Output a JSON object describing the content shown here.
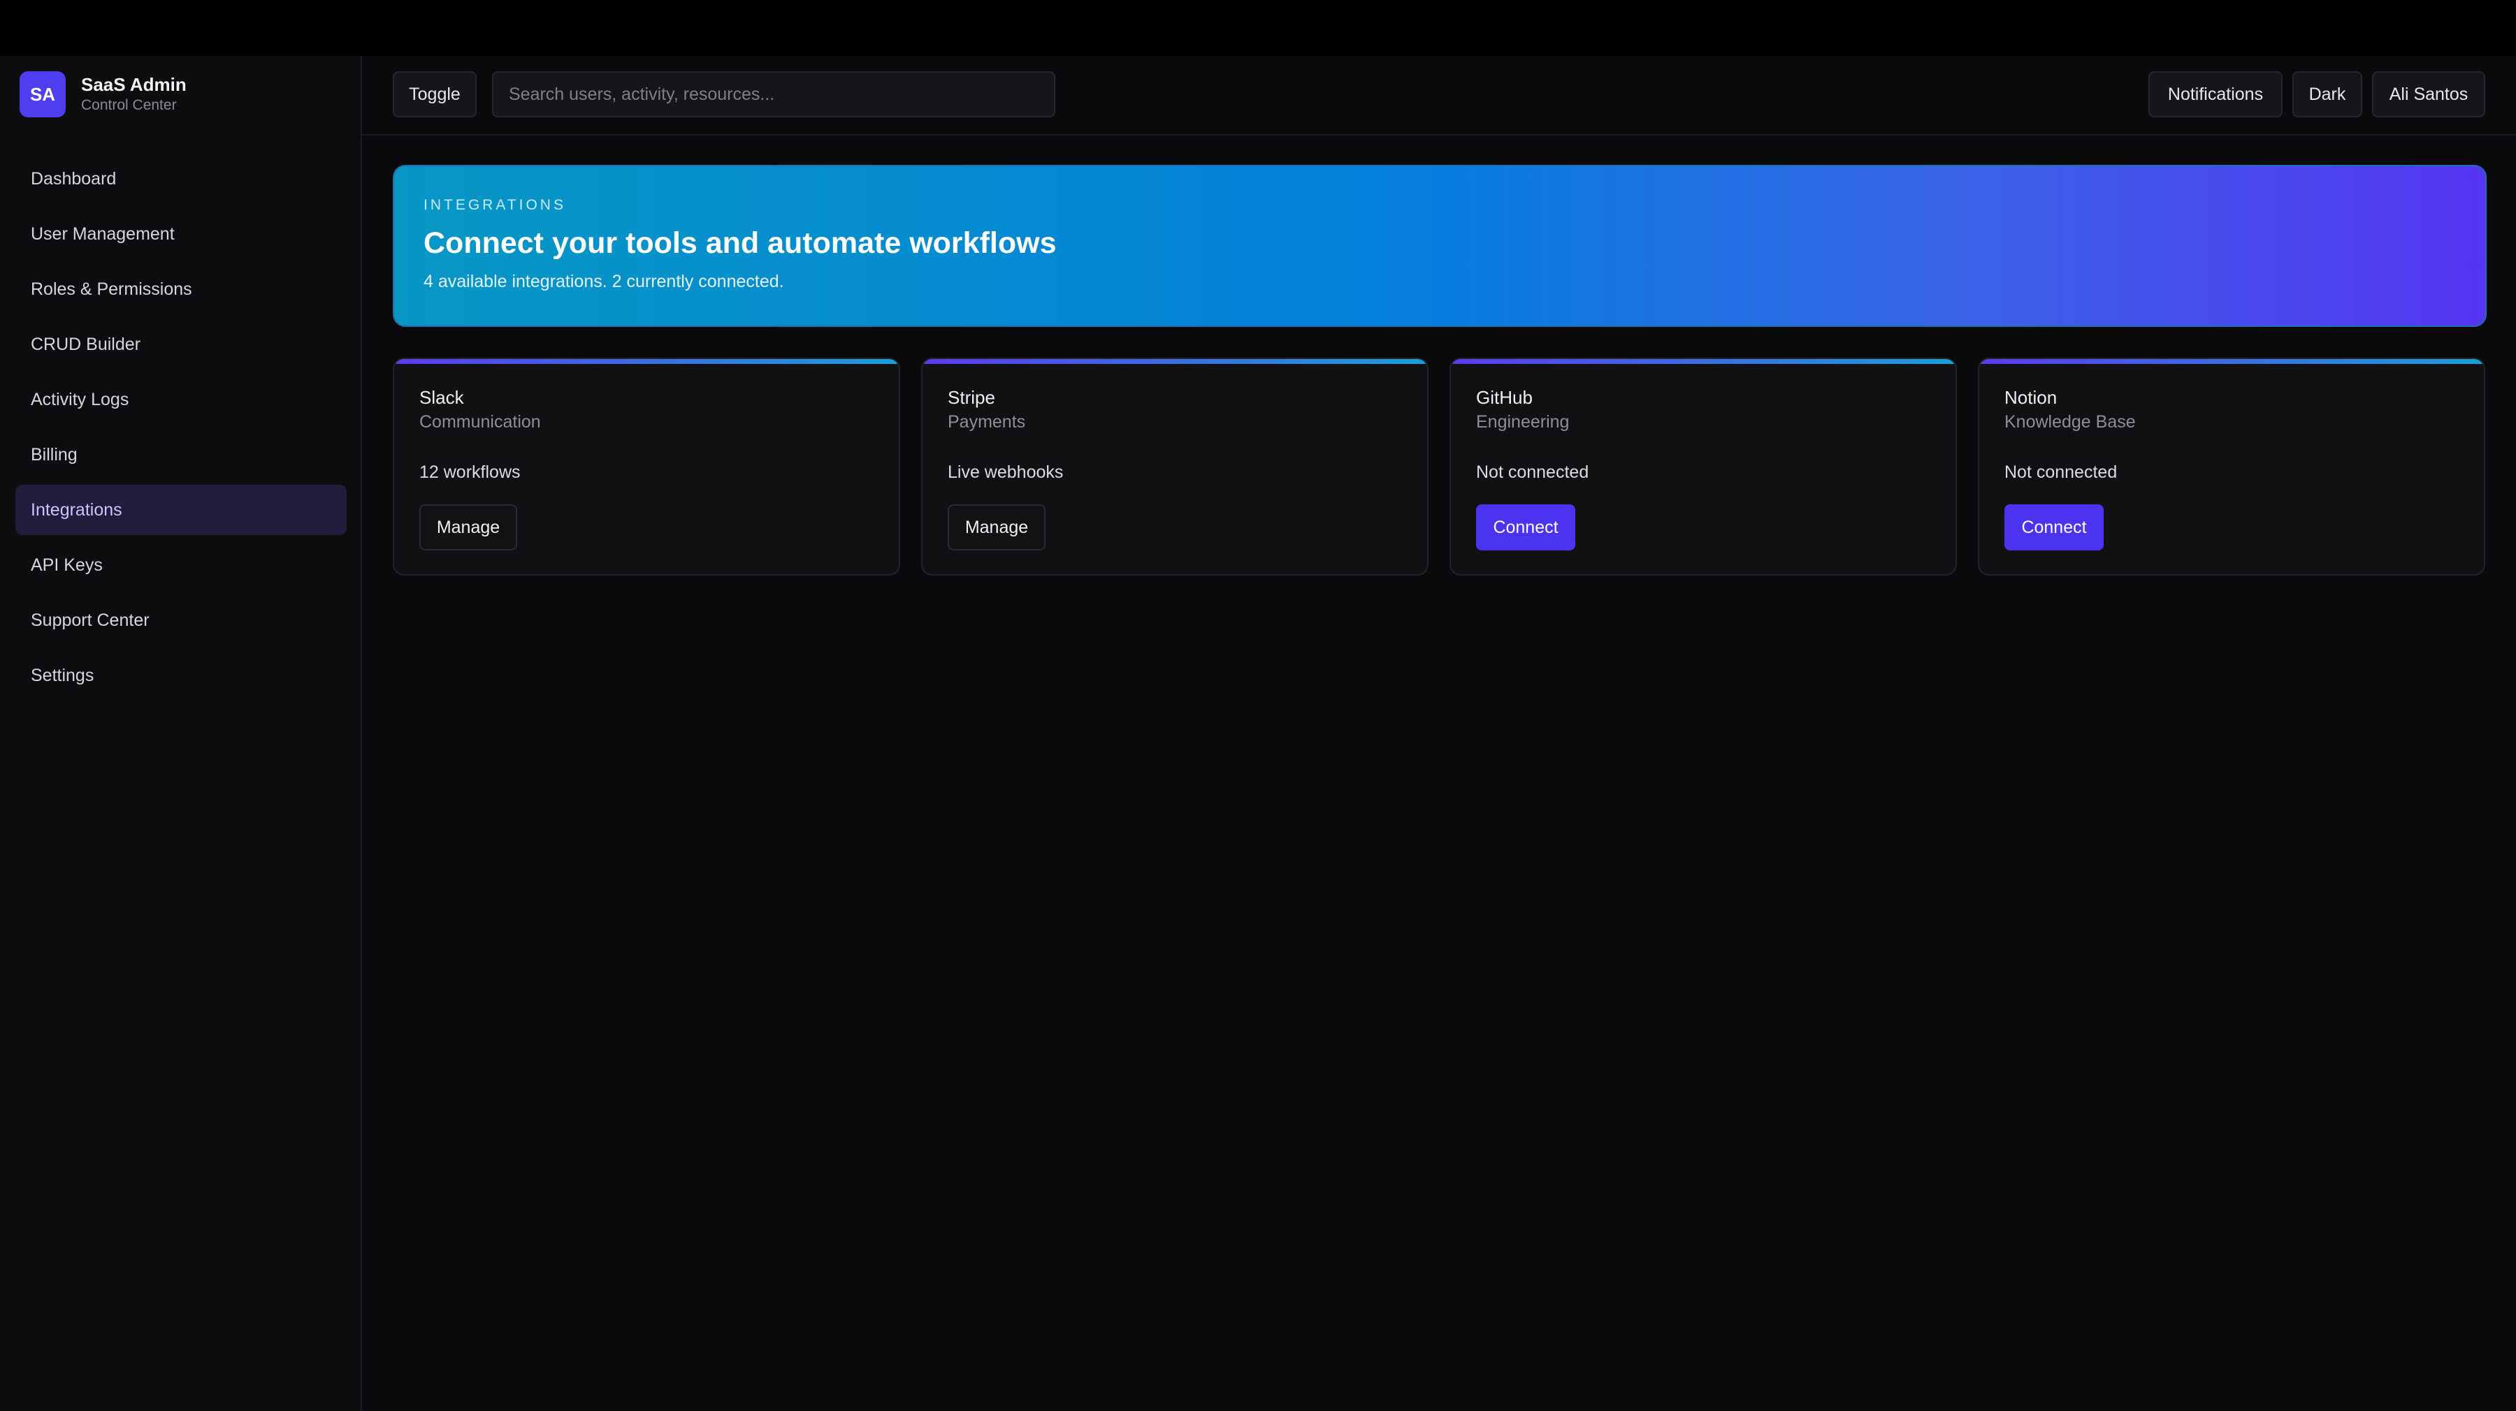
{
  "brand": {
    "initials": "SA",
    "name": "SaaS Admin",
    "subtitle": "Control Center"
  },
  "sidebar": {
    "items": [
      {
        "label": "Dashboard"
      },
      {
        "label": "User Management"
      },
      {
        "label": "Roles & Permissions"
      },
      {
        "label": "CRUD Builder"
      },
      {
        "label": "Activity Logs"
      },
      {
        "label": "Billing"
      },
      {
        "label": "Integrations",
        "active": true
      },
      {
        "label": "API Keys"
      },
      {
        "label": "Support Center"
      },
      {
        "label": "Settings"
      }
    ]
  },
  "topbar": {
    "toggle_label": "Toggle",
    "search_placeholder": "Search users, activity, resources...",
    "notifications_label": "Notifications",
    "theme_label": "Dark",
    "user_label": "Ali Santos"
  },
  "hero": {
    "eyebrow": "INTEGRATIONS",
    "title": "Connect your tools and automate workflows",
    "subtitle": "4 available integrations. 2 currently connected."
  },
  "integrations": [
    {
      "name": "Slack",
      "category": "Communication",
      "status": "12 workflows",
      "action": "Manage"
    },
    {
      "name": "Stripe",
      "category": "Payments",
      "status": "Live webhooks",
      "action": "Manage"
    },
    {
      "name": "GitHub",
      "category": "Engineering",
      "status": "Not connected",
      "action": "Connect"
    },
    {
      "name": "Notion",
      "category": "Knowledge Base",
      "status": "Not connected",
      "action": "Connect"
    }
  ],
  "colors": {
    "accent": "#4a34f0",
    "background": "#0a0a0c",
    "active_nav": "#1f1d3b",
    "hero_start": "#0797c4",
    "hero_end": "#5535f2"
  }
}
